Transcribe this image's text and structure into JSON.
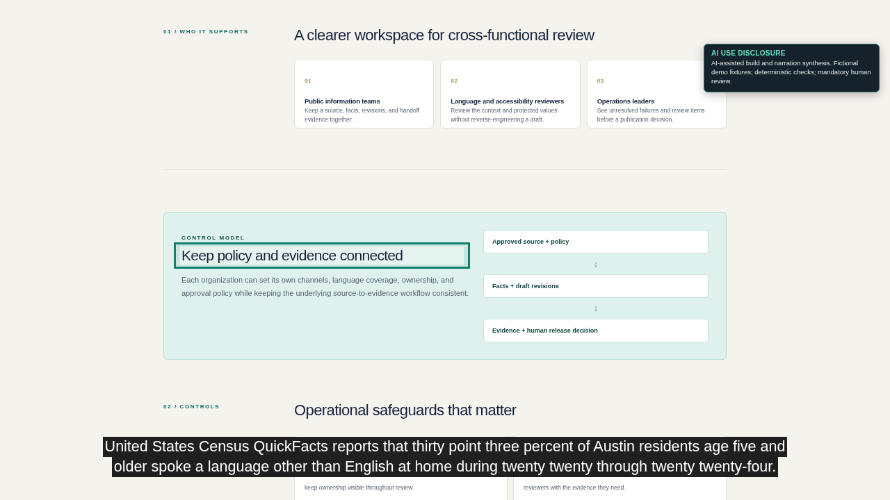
{
  "section_1": {
    "eyebrow": "01 / WHO IT SUPPORTS",
    "title": "A clearer workspace for cross-functional review",
    "cards": [
      {
        "number": "01",
        "title": "Public information teams",
        "text": "Keep a source, facts, revisions, and handoff evidence together."
      },
      {
        "number": "02",
        "title": "Language and accessibility reviewers",
        "text": "Review the context and protected values without reverse-engineering a draft."
      },
      {
        "number": "03",
        "title": "Operations leaders",
        "text": "See unresolved failures and review items before a publication decision."
      }
    ]
  },
  "control_model": {
    "eyebrow": "CONTROL MODEL",
    "title": "Keep policy and evidence connected",
    "focused": true,
    "text": "Each organization can set its own channels, language coverage, ownership, and approval policy while keeping the underlying source-to-evidence workflow consistent.",
    "flow": [
      {
        "label": "Approved source + policy"
      },
      {
        "label": "Facts + draft revisions"
      },
      {
        "label": "Evidence + human release decision"
      }
    ],
    "arrows": [
      "↓",
      "↓"
    ]
  },
  "section_2": {
    "eyebrow": "02 / CONTROLS",
    "title": "Operational safeguards that matter",
    "cards": [
      {
        "text": "keep ownership visible throughout review."
      },
      {
        "text": "reviewers with the evidence they need."
      }
    ]
  },
  "disclosure": {
    "title": "AI USE DISCLOSURE",
    "text": "AI-assisted build and narration synthesis. Fictional demo fixtures; deterministic checks; mandatory human review."
  },
  "captions": [
    "United States Census QuickFacts reports that thirty point three percent of Austin residents age five and",
    "older spoke a language other than English at home during twenty twenty through twenty twenty-four."
  ]
}
